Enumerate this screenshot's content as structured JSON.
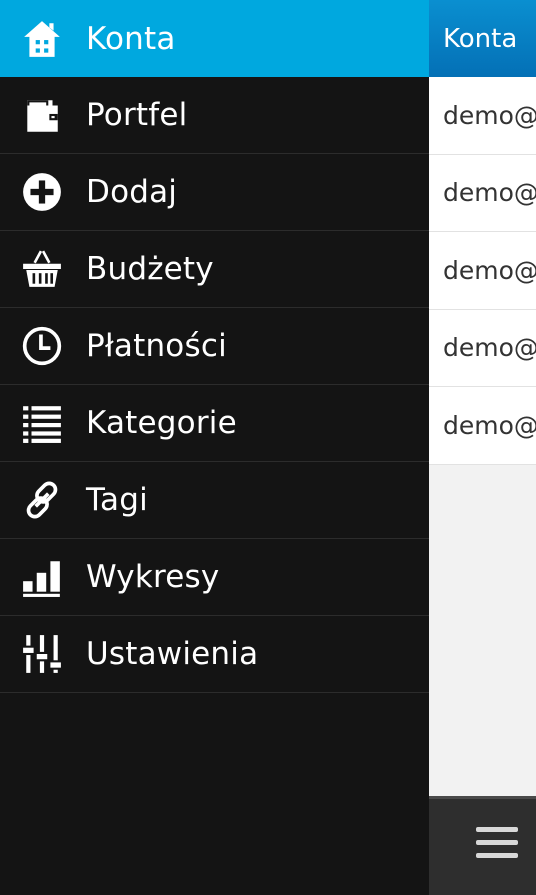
{
  "drawer": {
    "items": [
      {
        "label": "Konta",
        "icon": "home-icon",
        "active": true
      },
      {
        "label": "Portfel",
        "icon": "wallet-icon"
      },
      {
        "label": "Dodaj",
        "icon": "plus-circle-icon"
      },
      {
        "label": "Budżety",
        "icon": "basket-icon"
      },
      {
        "label": "Płatności",
        "icon": "clock-icon"
      },
      {
        "label": "Kategorie",
        "icon": "list-icon"
      },
      {
        "label": "Tagi",
        "icon": "link-icon"
      },
      {
        "label": "Wykresy",
        "icon": "bar-chart-icon"
      },
      {
        "label": "Ustawienia",
        "icon": "sliders-icon"
      }
    ]
  },
  "main": {
    "header_title": "Konta",
    "accounts": [
      "demo@",
      "demo@",
      "demo@",
      "demo@",
      "demo@"
    ]
  },
  "colors": {
    "accent": "#00a8df",
    "drawer_bg": "#141414",
    "header_blue": "#0470b6"
  }
}
